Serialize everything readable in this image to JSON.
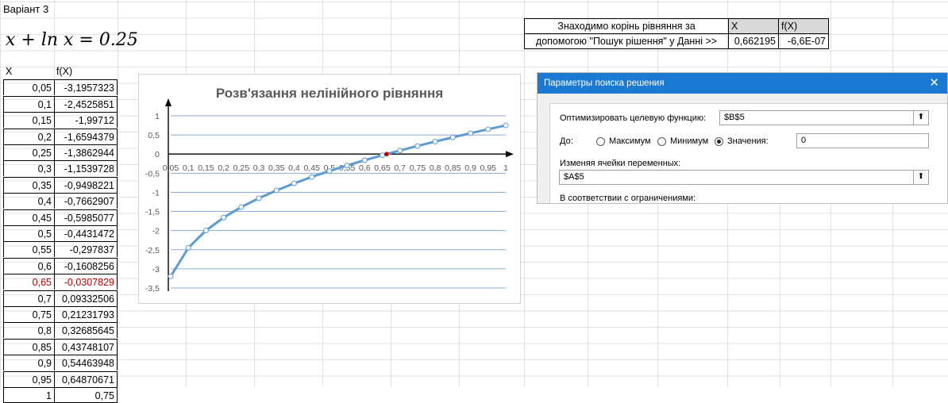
{
  "variant": "Варіант 3",
  "formula": "x + ln x = 0.25",
  "table": {
    "headers": [
      "X",
      "f(X)"
    ],
    "highlight_row": 12,
    "highlight_color": "#c00000",
    "rows": [
      {
        "x": "0,05",
        "fx": "-3,1957323"
      },
      {
        "x": "0,1",
        "fx": "-2,4525851"
      },
      {
        "x": "0,15",
        "fx": "-1,99712"
      },
      {
        "x": "0,2",
        "fx": "-1,6594379"
      },
      {
        "x": "0,25",
        "fx": "-1,3862944"
      },
      {
        "x": "0,3",
        "fx": "-1,1539728"
      },
      {
        "x": "0,35",
        "fx": "-0,9498221"
      },
      {
        "x": "0,4",
        "fx": "-0,7662907"
      },
      {
        "x": "0,45",
        "fx": "-0,5985077"
      },
      {
        "x": "0,5",
        "fx": "-0,4431472"
      },
      {
        "x": "0,55",
        "fx": "-0,297837"
      },
      {
        "x": "0,6",
        "fx": "-0,1608256"
      },
      {
        "x": "0,65",
        "fx": "-0,0307829"
      },
      {
        "x": "0,7",
        "fx": "0,09332506"
      },
      {
        "x": "0,75",
        "fx": "0,21231793"
      },
      {
        "x": "0,8",
        "fx": "0,32685645"
      },
      {
        "x": "0,85",
        "fx": "0,43748107"
      },
      {
        "x": "0,9",
        "fx": "0,54463948"
      },
      {
        "x": "0,95",
        "fx": "0,64870671"
      },
      {
        "x": "1",
        "fx": "0,75"
      }
    ]
  },
  "summary": {
    "label_line1": "Знаходимо корінь рівняння за",
    "label_line2": "допомогою \"Пошук рішення\" у Данні >>",
    "x_header": "X",
    "fx_header": "f(X)",
    "x_value": "0,662195",
    "fx_value": "-6,6E-07"
  },
  "chart_data": {
    "type": "line",
    "title": "Розв'язання нелінійного рівняння",
    "x": [
      "0,05",
      "0,1",
      "0,15",
      "0,2",
      "0,25",
      "0,3",
      "0,35",
      "0,4",
      "0,45",
      "0,5",
      "0,55",
      "0,6",
      "0,65",
      "0,7",
      "0,75",
      "0,8",
      "0,85",
      "0,9",
      "0,95",
      "1"
    ],
    "x_values": [
      0.05,
      0.1,
      0.15,
      0.2,
      0.25,
      0.3,
      0.35,
      0.4,
      0.45,
      0.5,
      0.55,
      0.6,
      0.65,
      0.7,
      0.75,
      0.8,
      0.85,
      0.9,
      0.95,
      1
    ],
    "values": [
      -3.1957323,
      -2.4525851,
      -1.99712,
      -1.6594379,
      -1.3862944,
      -1.1539728,
      -0.9498221,
      -0.7662907,
      -0.5985077,
      -0.4431472,
      -0.297837,
      -0.1608256,
      -0.0307829,
      0.09332506,
      0.21231793,
      0.32685645,
      0.43748107,
      0.54463948,
      0.64870671,
      0.75
    ],
    "root": {
      "x": 0.662195,
      "y": -6.6e-07
    },
    "ylim": [
      -3.5,
      1
    ],
    "yticks": [
      "1",
      "0,5",
      "0",
      "-0,5",
      "-1",
      "-1,5",
      "-2",
      "-2,5",
      "-3",
      "-3,5"
    ],
    "ytick_values": [
      1,
      0.5,
      0,
      -0.5,
      -1,
      -1.5,
      -2,
      -2.5,
      -3,
      -3.5
    ],
    "grid": true,
    "line_color": "#5b9bd5",
    "root_color": "#c00000",
    "grid_color": "#8eaadb"
  },
  "solver": {
    "title": "Параметры поиска решения",
    "close_icon": "close-icon",
    "objective_label": "Оптимизировать целевую функцию:",
    "objective_value": "$B$5",
    "to_label": "До:",
    "opt_max": "Максимум",
    "opt_min": "Минимум",
    "opt_value": "Значения:",
    "selected": "value",
    "target_value": "0",
    "changing_label": "Изменяя ячейки переменных:",
    "changing_value": "$A$5",
    "constraints_label": "В соответствии с ограничениями:",
    "accent_color": "#1979d3"
  }
}
